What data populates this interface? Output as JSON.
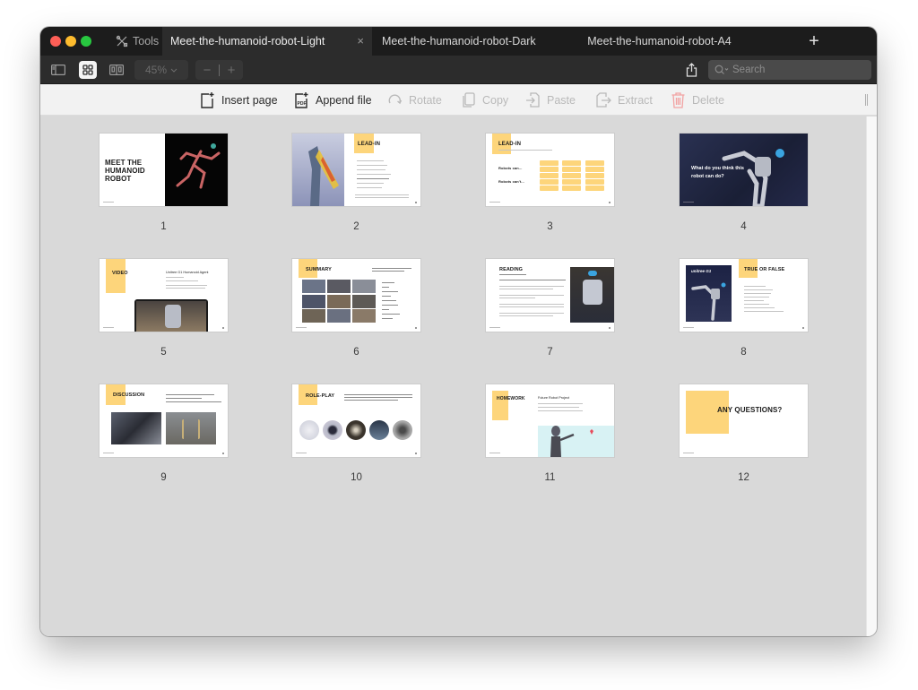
{
  "window": {
    "tools_label": "Tools",
    "tabs": [
      {
        "label": "Meet-the-humanoid-robot-Light",
        "active": true
      },
      {
        "label": "Meet-the-humanoid-robot-Dark",
        "active": false
      },
      {
        "label": "Meet-the-humanoid-robot-A4",
        "active": false
      }
    ],
    "close_glyph": "×",
    "new_tab_glyph": "+"
  },
  "toolbar": {
    "zoom_level": "45%",
    "zoom_out": "−",
    "zoom_in": "+",
    "search_placeholder": "Search",
    "view_mode": "grid"
  },
  "actions": [
    {
      "label": "Insert page",
      "icon": "insert-page-icon",
      "enabled": true
    },
    {
      "label": "Append file",
      "icon": "append-pdf-icon",
      "enabled": true
    },
    {
      "label": "Rotate",
      "icon": "rotate-icon",
      "enabled": false
    },
    {
      "label": "Copy",
      "icon": "copy-icon",
      "enabled": false
    },
    {
      "label": "Paste",
      "icon": "paste-icon",
      "enabled": false
    },
    {
      "label": "Extract",
      "icon": "extract-icon",
      "enabled": false
    },
    {
      "label": "Delete",
      "icon": "trash-icon",
      "enabled": false
    }
  ],
  "colors": {
    "accent_yellow": "#fdd57b",
    "delete_red": "#f2a3a3"
  },
  "pages": [
    {
      "number": "1",
      "title": "MEET THE HUMANOID ROBOT"
    },
    {
      "number": "2",
      "title": "LEAD-IN"
    },
    {
      "number": "3",
      "title": "LEAD-IN",
      "labels": [
        "Robots can...",
        "Robots can't..."
      ]
    },
    {
      "number": "4",
      "title": "What do you think this robot can do?"
    },
    {
      "number": "5",
      "title": "VIDEO",
      "subtitle": "Unitree G1 Humanoid Agent"
    },
    {
      "number": "6",
      "title": "SUMMARY"
    },
    {
      "number": "7",
      "title": "READING"
    },
    {
      "number": "8",
      "title": "TRUE OR FALSE",
      "brand": "unitree G1"
    },
    {
      "number": "9",
      "title": "DISCUSSION"
    },
    {
      "number": "10",
      "title": "ROLE-PLAY"
    },
    {
      "number": "11",
      "title": "HOMEWORK",
      "subtitle": "Future Robot Project"
    },
    {
      "number": "12",
      "title": "ANY QUESTIONS?"
    }
  ]
}
